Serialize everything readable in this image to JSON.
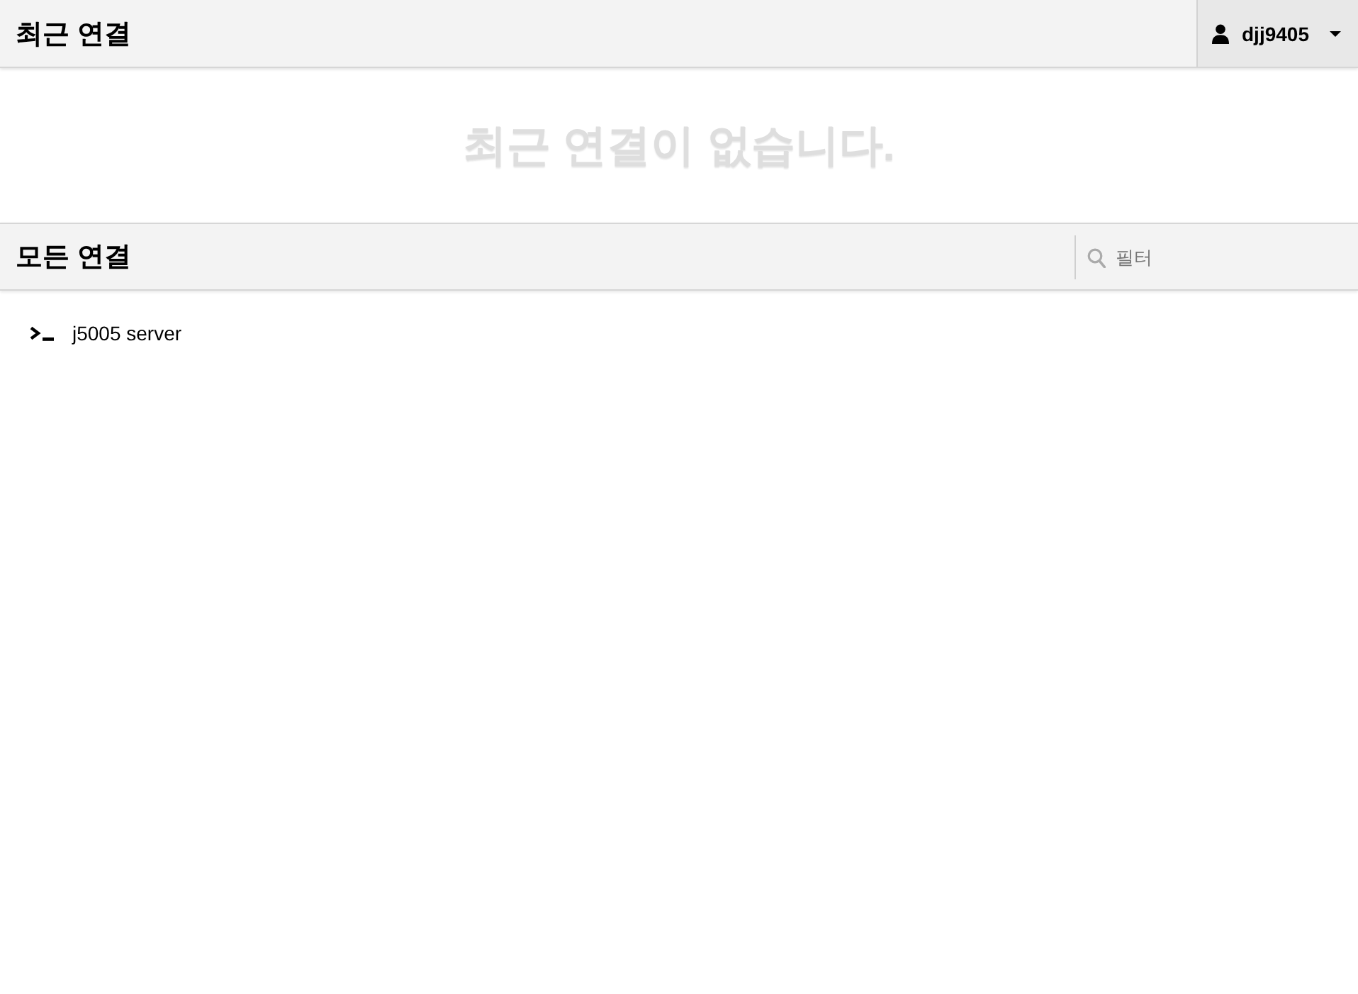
{
  "header": {
    "title": "최근 연결",
    "user_menu": {
      "username": "djj9405"
    }
  },
  "recent": {
    "empty_message": "최근 연결이 없습니다."
  },
  "all_connections": {
    "title": "모든 연결",
    "filter": {
      "placeholder": "필터"
    },
    "connections": [
      {
        "name": "j5005 server"
      }
    ]
  }
}
